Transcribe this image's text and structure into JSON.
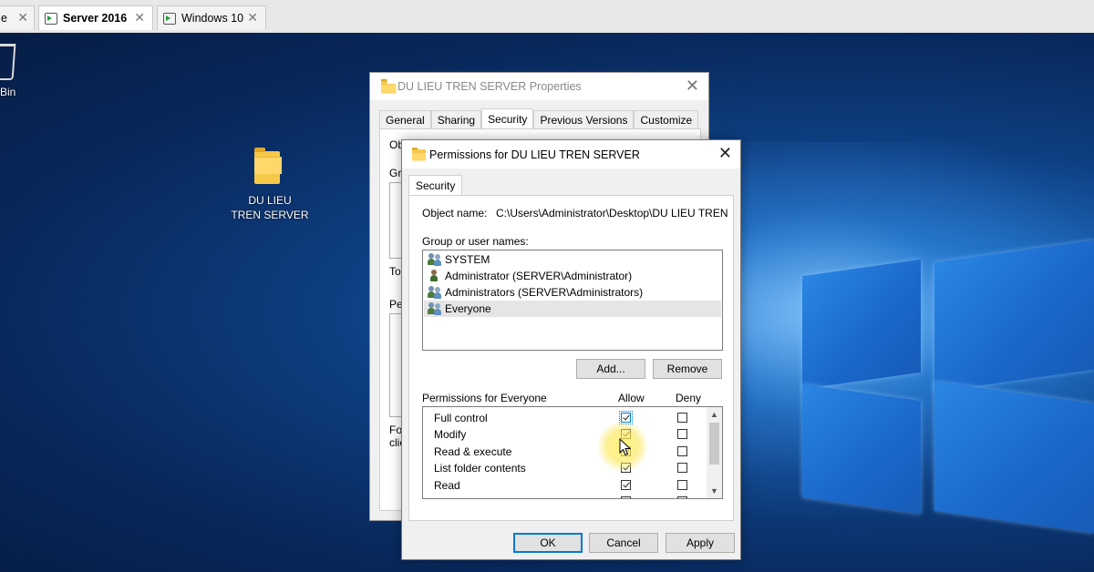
{
  "vm_tabs": [
    {
      "label": "e",
      "active": false
    },
    {
      "label": "Server 2016",
      "active": true
    },
    {
      "label": "Windows 10",
      "active": false
    }
  ],
  "desktop": {
    "recycle_bin_label": "Bin",
    "folder_label": "DU LIEU\nTREN SERVER"
  },
  "properties_window": {
    "title": "DU LIEU TREN SERVER Properties",
    "tabs": [
      "General",
      "Sharing",
      "Security",
      "Previous Versions",
      "Customize"
    ],
    "selected_tab": "Security",
    "fragments": {
      "ob": "Ob",
      "gr": "Gr",
      "to": "To",
      "pe": "Pe",
      "fo": "Fo",
      "cli": "clic"
    }
  },
  "permissions_dialog": {
    "title": "Permissions for DU LIEU TREN SERVER",
    "tab": "Security",
    "object_name_label": "Object name:",
    "object_name_value": "C:\\Users\\Administrator\\Desktop\\DU LIEU TREN S",
    "group_label": "Group or user names:",
    "users": [
      {
        "name": "SYSTEM",
        "icon": "users-group-icon",
        "selected": false
      },
      {
        "name": "Administrator (SERVER\\Administrator)",
        "icon": "user-icon",
        "selected": false
      },
      {
        "name": "Administrators (SERVER\\Administrators)",
        "icon": "users-group-icon",
        "selected": false
      },
      {
        "name": "Everyone",
        "icon": "users-group-icon",
        "selected": true
      }
    ],
    "add_button": "Add...",
    "remove_button": "Remove",
    "permissions_for_label": "Permissions for Everyone",
    "allow_header": "Allow",
    "deny_header": "Deny",
    "permissions": [
      {
        "name": "Full control",
        "allow": true,
        "deny": false
      },
      {
        "name": "Modify",
        "allow": true,
        "deny": false
      },
      {
        "name": "Read & execute",
        "allow": true,
        "deny": false
      },
      {
        "name": "List folder contents",
        "allow": true,
        "deny": false
      },
      {
        "name": "Read",
        "allow": true,
        "deny": false
      }
    ],
    "ok_button": "OK",
    "cancel_button": "Cancel",
    "apply_button": "Apply"
  }
}
